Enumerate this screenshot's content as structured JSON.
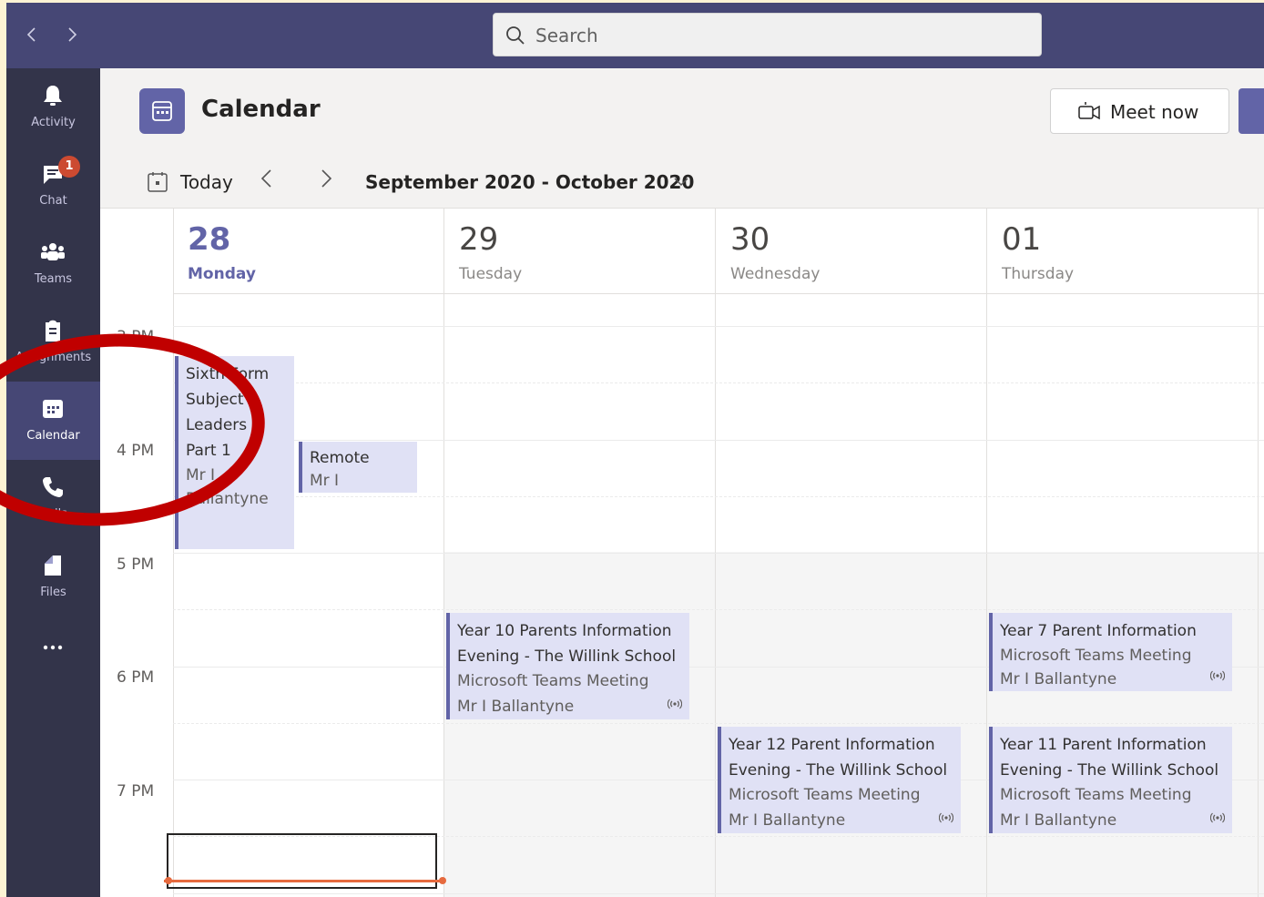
{
  "topbar": {
    "back_icon": "chevron-left-icon",
    "forward_icon": "chevron-right-icon",
    "search_placeholder": "Search"
  },
  "rail": {
    "items": [
      {
        "label": "Activity",
        "icon": "bell-icon"
      },
      {
        "label": "Chat",
        "icon": "chat-icon",
        "badge": "1"
      },
      {
        "label": "Teams",
        "icon": "teams-icon"
      },
      {
        "label": "Assignments",
        "icon": "assignments-icon"
      },
      {
        "label": "Calendar",
        "icon": "calendar-icon",
        "active": true
      },
      {
        "label": "Calls",
        "icon": "phone-icon"
      },
      {
        "label": "Files",
        "icon": "file-icon"
      },
      {
        "label": "...",
        "icon": "more-icon"
      }
    ]
  },
  "header": {
    "title": "Calendar",
    "meet_now": "Meet now"
  },
  "toolbar": {
    "today": "Today",
    "range": "September 2020 - October 2020"
  },
  "days": [
    {
      "num": "28",
      "name": "Monday",
      "today": true
    },
    {
      "num": "29",
      "name": "Tuesday"
    },
    {
      "num": "30",
      "name": "Wednesday"
    },
    {
      "num": "01",
      "name": "Thursday"
    }
  ],
  "times": [
    "3 PM",
    "4 PM",
    "5 PM",
    "6 PM",
    "7 PM"
  ],
  "events": [
    {
      "title": "Sixth Form Subject Leaders - Part 1",
      "organizer": "Mr I Ballantyne"
    },
    {
      "title": "Remote",
      "organizer": "Mr I"
    },
    {
      "title": "Year 10 Parents Information Evening - The Willink School",
      "subtitle": "Microsoft Teams Meeting",
      "organizer": "Mr I Ballantyne"
    },
    {
      "title": "Year 12 Parent Information Evening - The Willink School",
      "subtitle": "Microsoft Teams Meeting",
      "organizer": "Mr I Ballantyne"
    },
    {
      "title": "Year 7 Parent Information",
      "subtitle": "Microsoft Teams Meeting",
      "organizer": "Mr I Ballantyne"
    },
    {
      "title": "Year 11 Parent Information Evening - The Willink School",
      "subtitle": "Microsoft Teams Meeting",
      "organizer": "Mr I Ballantyne"
    }
  ],
  "colors": {
    "brand": "#6264a7",
    "topbar": "#464775",
    "rail": "#33344a",
    "badge": "#cc4a31",
    "annotation": "#c00000",
    "now_line": "#e66a3e"
  }
}
